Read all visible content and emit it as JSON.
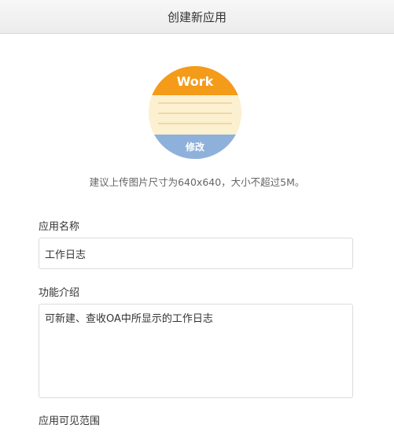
{
  "header": {
    "title": "创建新应用"
  },
  "icon": {
    "top_text": "Work",
    "modify_label": "修改",
    "colors": {
      "top": "#f49b1a",
      "paper": "#fbf0d0",
      "lines": "#f0d9a5",
      "bottom": "#8eb1dc"
    }
  },
  "upload_hint": "建议上传图片尺寸为640x640，大小不超过5M。",
  "form": {
    "name_label": "应用名称",
    "name_value": "工作日志",
    "desc_label": "功能介绍",
    "desc_value": "可新建、查收OA中所显示的工作日志",
    "visibility_label": "应用可见范围"
  }
}
